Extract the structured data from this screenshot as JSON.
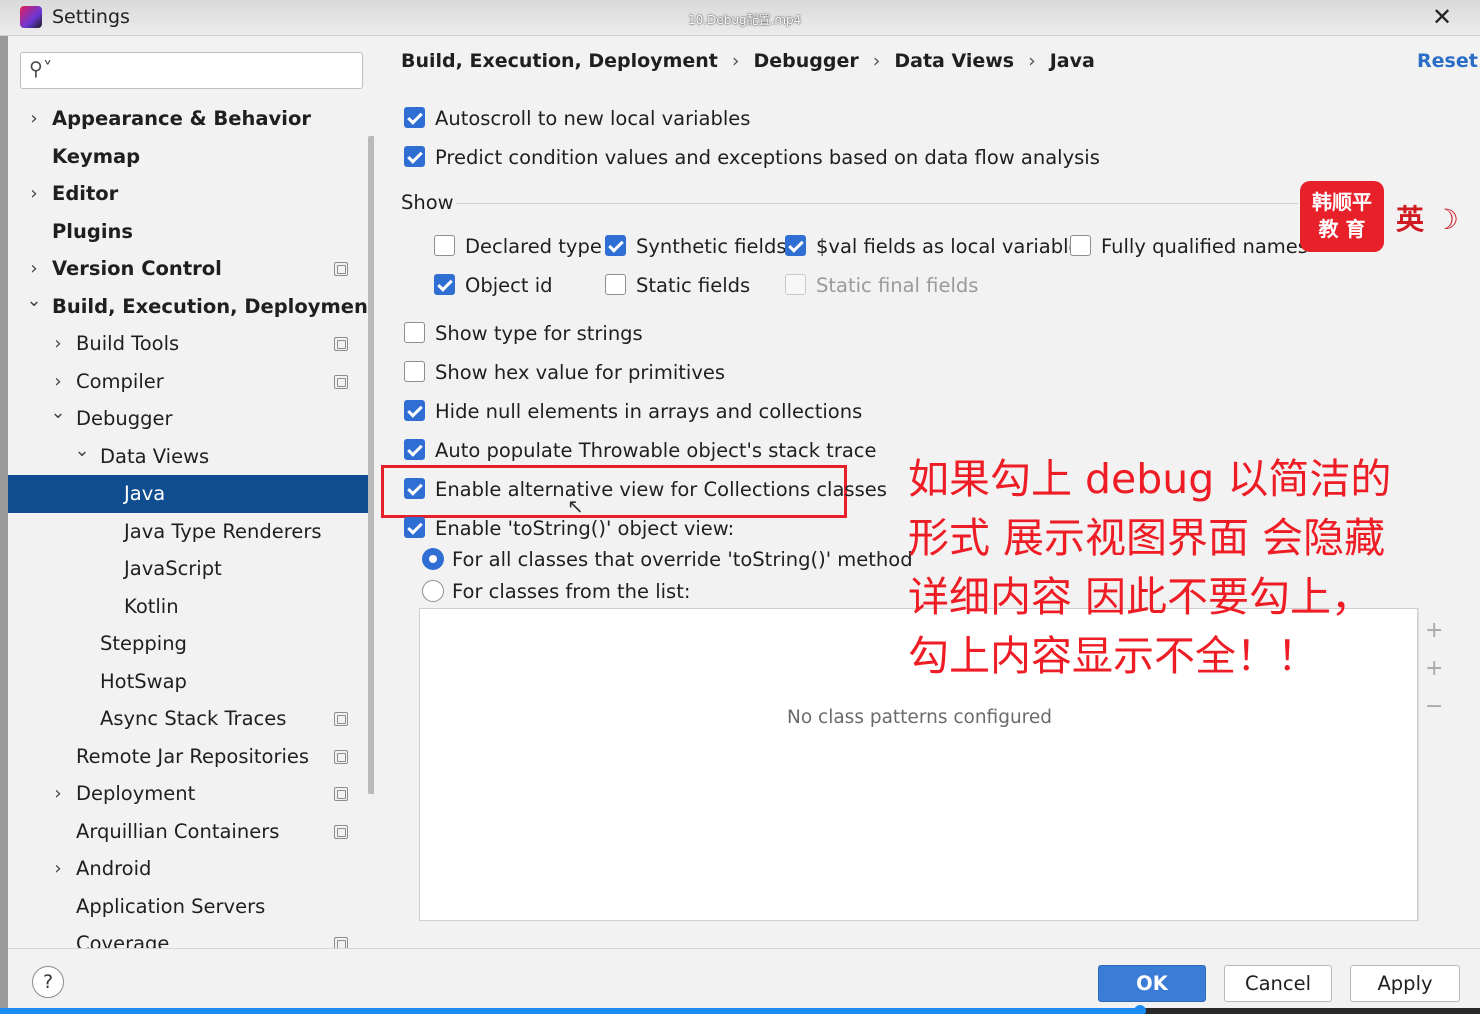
{
  "window": {
    "title": "Settings",
    "video_title": "10.Debug配置.mp4",
    "close_glyph": "✕"
  },
  "search": {
    "placeholder": "",
    "icon": "search-icon"
  },
  "tree": [
    {
      "label": "Appearance & Behavior",
      "bold": true,
      "chev": "›",
      "indent": 0,
      "project": false,
      "selected": false
    },
    {
      "label": "Keymap",
      "bold": true,
      "chev": "",
      "indent": 0,
      "project": false,
      "selected": false
    },
    {
      "label": "Editor",
      "bold": true,
      "chev": "›",
      "indent": 0,
      "project": false,
      "selected": false
    },
    {
      "label": "Plugins",
      "bold": true,
      "chev": "",
      "indent": 0,
      "project": false,
      "selected": false
    },
    {
      "label": "Version Control",
      "bold": true,
      "chev": "›",
      "indent": 0,
      "project": true,
      "selected": false
    },
    {
      "label": "Build, Execution, Deployment",
      "bold": true,
      "chev": "⌄",
      "indent": 0,
      "project": false,
      "selected": false
    },
    {
      "label": "Build Tools",
      "bold": false,
      "chev": "›",
      "indent": 1,
      "project": true,
      "selected": false
    },
    {
      "label": "Compiler",
      "bold": false,
      "chev": "›",
      "indent": 1,
      "project": true,
      "selected": false
    },
    {
      "label": "Debugger",
      "bold": false,
      "chev": "⌄",
      "indent": 1,
      "project": false,
      "selected": false
    },
    {
      "label": "Data Views",
      "bold": false,
      "chev": "⌄",
      "indent": 2,
      "project": false,
      "selected": false
    },
    {
      "label": "Java",
      "bold": false,
      "chev": "",
      "indent": 3,
      "project": false,
      "selected": true
    },
    {
      "label": "Java Type Renderers",
      "bold": false,
      "chev": "",
      "indent": 3,
      "project": false,
      "selected": false
    },
    {
      "label": "JavaScript",
      "bold": false,
      "chev": "",
      "indent": 3,
      "project": false,
      "selected": false
    },
    {
      "label": "Kotlin",
      "bold": false,
      "chev": "",
      "indent": 3,
      "project": false,
      "selected": false
    },
    {
      "label": "Stepping",
      "bold": false,
      "chev": "",
      "indent": 2,
      "project": false,
      "selected": false
    },
    {
      "label": "HotSwap",
      "bold": false,
      "chev": "",
      "indent": 2,
      "project": false,
      "selected": false
    },
    {
      "label": "Async Stack Traces",
      "bold": false,
      "chev": "",
      "indent": 2,
      "project": true,
      "selected": false
    },
    {
      "label": "Remote Jar Repositories",
      "bold": false,
      "chev": "",
      "indent": 1,
      "project": true,
      "selected": false
    },
    {
      "label": "Deployment",
      "bold": false,
      "chev": "›",
      "indent": 1,
      "project": true,
      "selected": false
    },
    {
      "label": "Arquillian Containers",
      "bold": false,
      "chev": "",
      "indent": 1,
      "project": true,
      "selected": false
    },
    {
      "label": "Android",
      "bold": false,
      "chev": "›",
      "indent": 1,
      "project": false,
      "selected": false
    },
    {
      "label": "Application Servers",
      "bold": false,
      "chev": "",
      "indent": 1,
      "project": false,
      "selected": false
    },
    {
      "label": "Coverage",
      "bold": false,
      "chev": "",
      "indent": 1,
      "project": true,
      "selected": false
    }
  ],
  "breadcrumb": {
    "items": [
      "Build, Execution, Deployment",
      "Debugger",
      "Data Views",
      "Java"
    ],
    "separator": "›"
  },
  "reset_label": "Reset",
  "options": {
    "autoscroll": {
      "label": "Autoscroll to new local variables",
      "checked": true
    },
    "predict": {
      "label": "Predict condition values and exceptions based on data flow analysis",
      "checked": true
    },
    "show_label": "Show",
    "declared_type": {
      "label": "Declared type",
      "checked": false
    },
    "synthetic_fields": {
      "label": "Synthetic fields",
      "checked": true
    },
    "val_fields": {
      "label": "$val fields as local variables",
      "checked": true
    },
    "fully_qualified": {
      "label": "Fully qualified names",
      "checked": false
    },
    "object_id": {
      "label": "Object id",
      "checked": true
    },
    "static_fields": {
      "label": "Static fields",
      "checked": false
    },
    "static_final_fields": {
      "label": "Static final fields",
      "checked": false,
      "disabled": true
    },
    "type_for_strings": {
      "label": "Show type for strings",
      "checked": false
    },
    "hex_value": {
      "label": "Show hex value for primitives",
      "checked": false
    },
    "hide_null": {
      "label": "Hide null elements in arrays and collections",
      "checked": true
    },
    "auto_populate": {
      "label": "Auto populate Throwable object's stack trace",
      "checked": true
    },
    "alt_view": {
      "label": "Enable alternative view for Collections classes",
      "checked": true
    },
    "tostring_view": {
      "label": "Enable 'toString()' object view:",
      "checked": true
    },
    "radio_all": {
      "label": "For all classes that override 'toString()' method",
      "selected": true
    },
    "radio_list": {
      "label": "For classes from the list:",
      "selected": false
    }
  },
  "class_list": {
    "empty_text": "No class patterns configured",
    "tools": [
      "+",
      "+",
      "−"
    ]
  },
  "annotation": {
    "lines": [
      "如果勾上 debug 以简洁的",
      "形式 展示视图界面 会隐藏",
      "详细内容 因此不要勾上，",
      "勾上内容显示不全！！"
    ],
    "color": "#ee1c24"
  },
  "badge": {
    "line1": "韩顺平",
    "line2": "教 育",
    "ime": "英 ☽"
  },
  "footer": {
    "help": "?",
    "ok": "OK",
    "cancel": "Cancel",
    "apply": "Apply"
  },
  "progress": {
    "fraction": 0.77
  },
  "colors": {
    "accent": "#2f6fd3",
    "selection": "#104c90",
    "link": "#2a6dc6"
  }
}
